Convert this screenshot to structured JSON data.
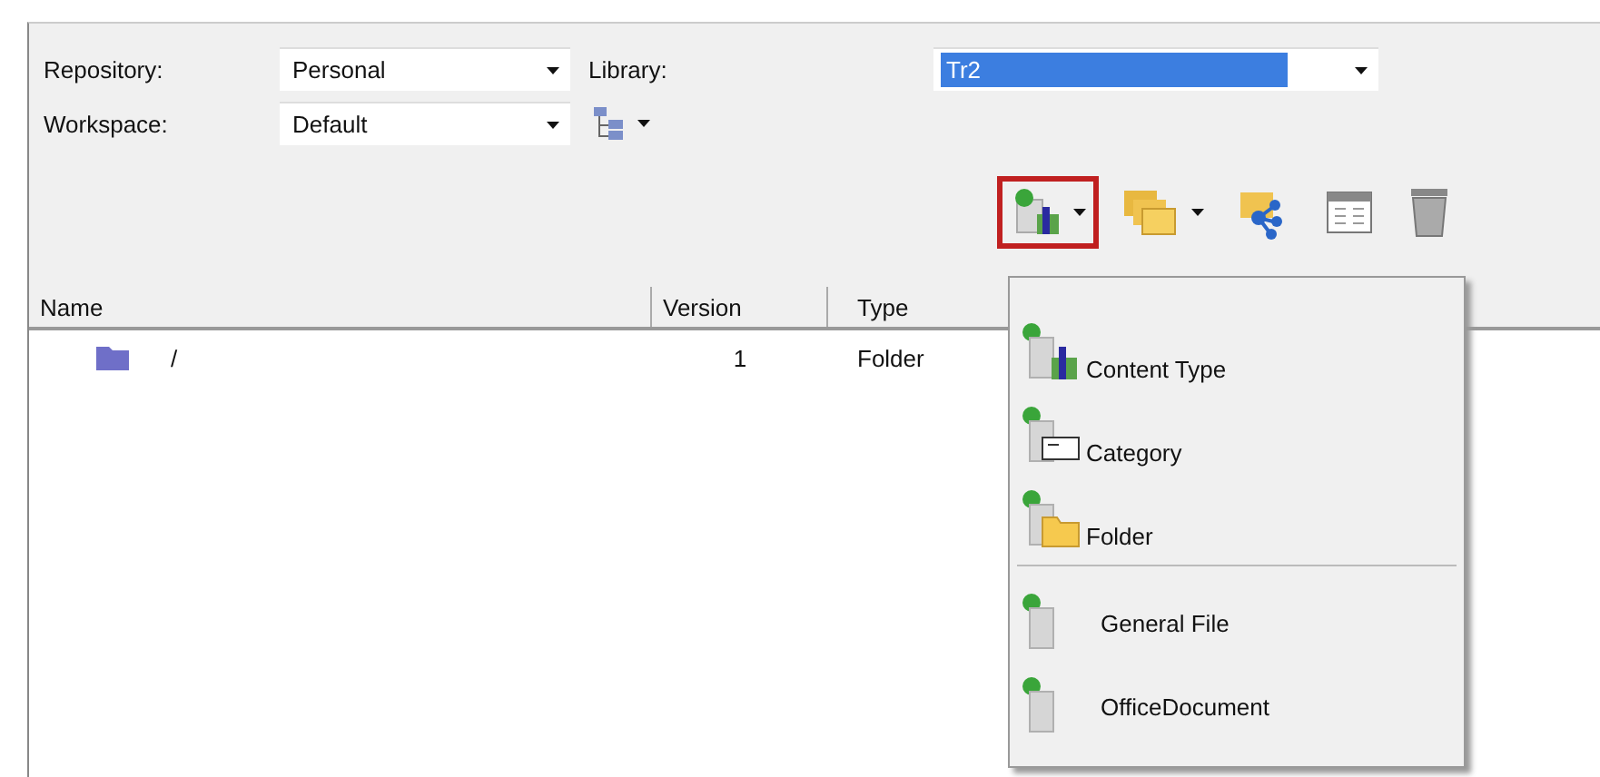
{
  "fields": [
    {
      "label": "Repository:",
      "value": "Personal",
      "focused": false
    },
    {
      "label": "Library:",
      "value": "Tr2",
      "focused": true
    },
    {
      "label": "Workspace:",
      "value": "Default",
      "focused": false
    }
  ],
  "view_button": {
    "dropdown": true
  },
  "toolbar": [
    {
      "kind": "new-item",
      "dropdown": true,
      "pressed": true
    },
    {
      "kind": "copy",
      "dropdown": true,
      "pressed": false
    },
    {
      "kind": "share",
      "dropdown": false,
      "pressed": false
    },
    {
      "kind": "properties",
      "dropdown": false,
      "pressed": false
    },
    {
      "kind": "delete",
      "dropdown": false,
      "pressed": false
    }
  ],
  "table": {
    "columns": [
      "Name",
      "Version",
      "Type"
    ],
    "rows": [
      {
        "name": "/",
        "version": "1",
        "type": "Folder"
      }
    ]
  },
  "menu": {
    "groups": [
      [
        {
          "label": "Content Type",
          "kind": "content-type"
        },
        {
          "label": "Category",
          "kind": "category"
        },
        {
          "label": "Folder",
          "kind": "folder"
        }
      ],
      [
        {
          "label": "General File",
          "kind": "file"
        },
        {
          "label": "OfficeDocument",
          "kind": "file"
        }
      ]
    ]
  }
}
